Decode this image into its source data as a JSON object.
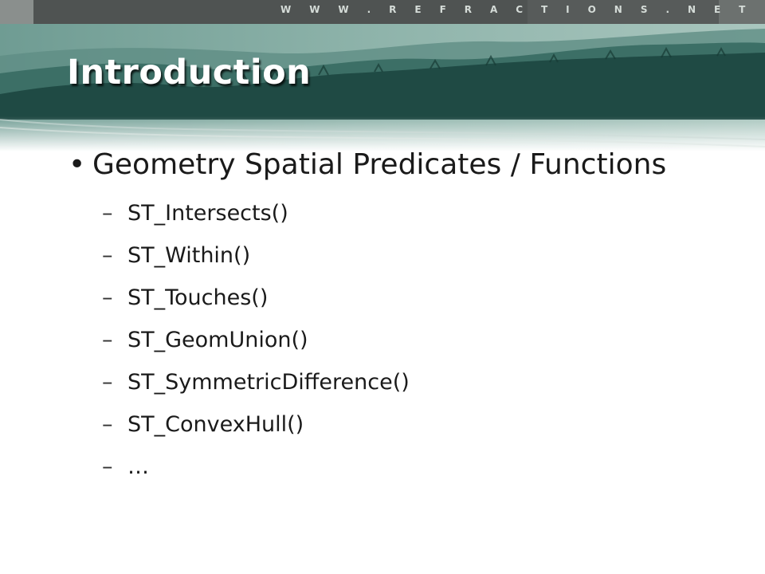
{
  "header": {
    "site_url": "W W W . R E F R A C T I O N S . N E T",
    "title": "Introduction"
  },
  "content": {
    "main_bullet": "Geometry Spatial Predicates / Functions",
    "sub_items": [
      "ST_Intersects()",
      "ST_Within()",
      "ST_Touches()",
      "ST_GeomUnion()",
      "ST_SymmetricDifference()",
      "ST_ConvexHull()",
      "…"
    ]
  },
  "colors": {
    "banner_dark": "#1f4a44",
    "banner_mid": "#3c6f66",
    "top_bar": "#4f5352",
    "text": "#1a1a1a"
  }
}
